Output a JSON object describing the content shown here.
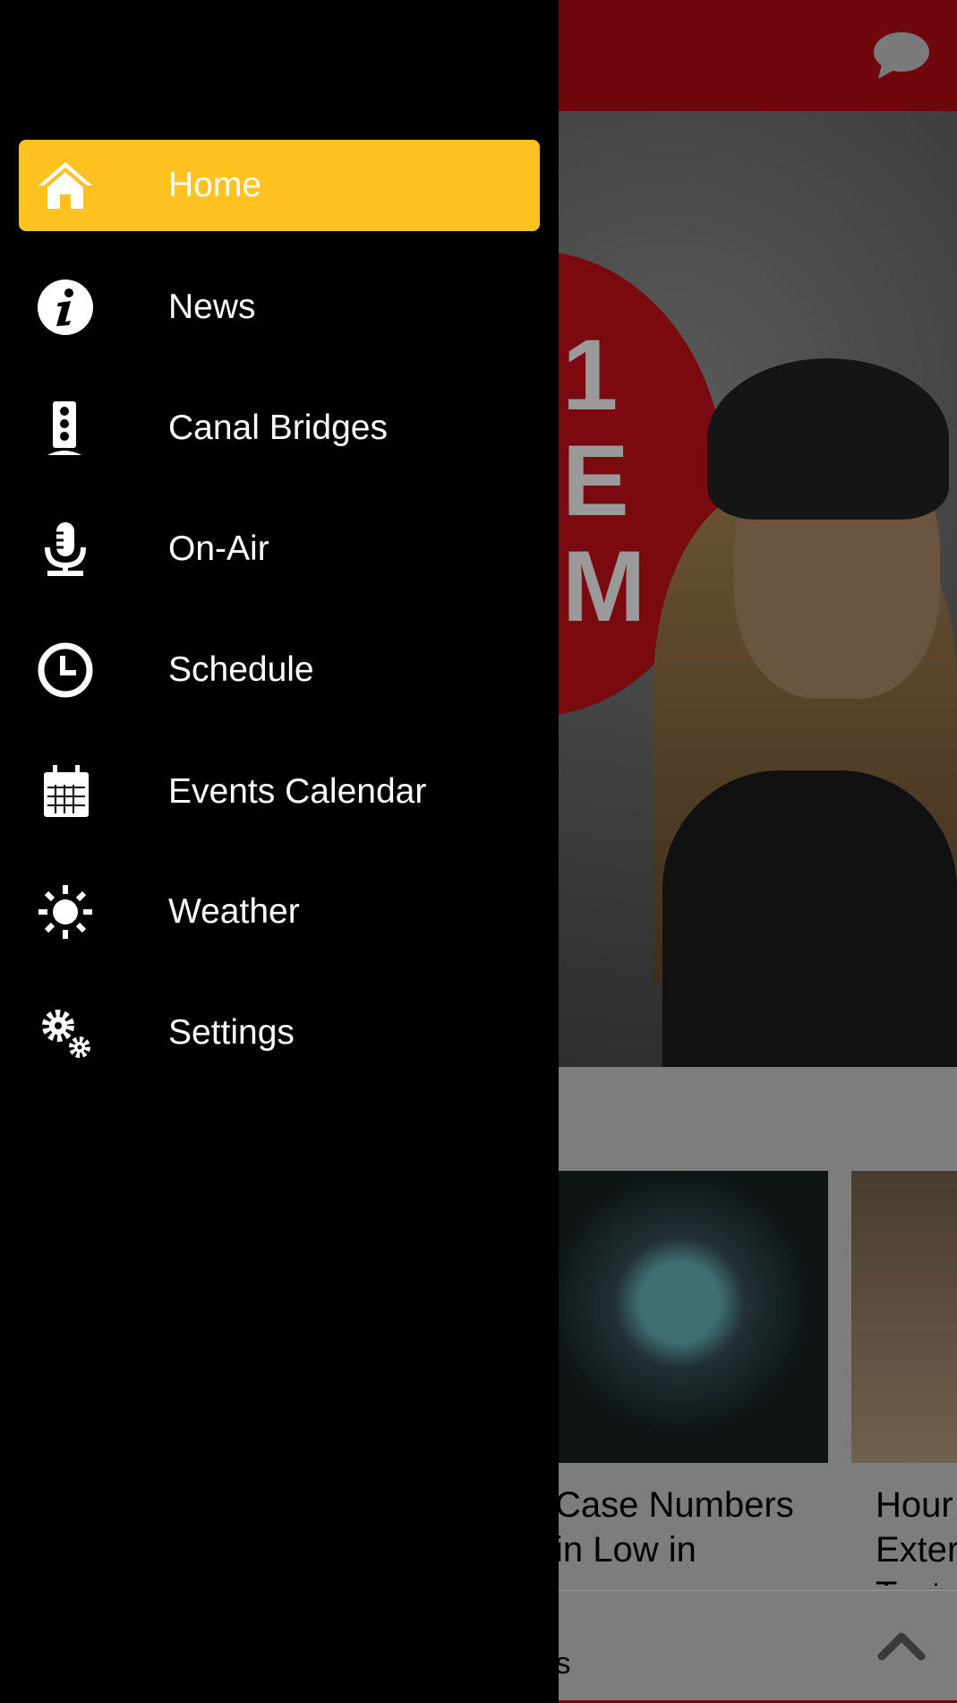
{
  "drawer": {
    "items": [
      {
        "label": "Home",
        "icon": "home-icon",
        "active": true
      },
      {
        "label": "News",
        "icon": "info-icon"
      },
      {
        "label": "Canal Bridges",
        "icon": "traffic-light-icon"
      },
      {
        "label": "On-Air",
        "icon": "microphone-icon"
      },
      {
        "label": "Schedule",
        "icon": "clock-icon"
      },
      {
        "label": "Events Calendar",
        "icon": "calendar-icon"
      },
      {
        "label": "Weather",
        "icon": "sun-icon"
      },
      {
        "label": "Settings",
        "icon": "gears-icon"
      }
    ],
    "active_color": "#ffc220"
  },
  "appbar": {
    "color": "#6f070d",
    "chat_icon": "chat-bubble-icon"
  },
  "hero": {
    "letters": "1\nE\nM"
  },
  "cards": [
    {
      "title": "Case Numbers\nin Low in"
    },
    {
      "title": "Hour\nExter\nTest"
    }
  ],
  "bottom": {
    "text": "'s",
    "icon": "chevron-up-icon"
  }
}
